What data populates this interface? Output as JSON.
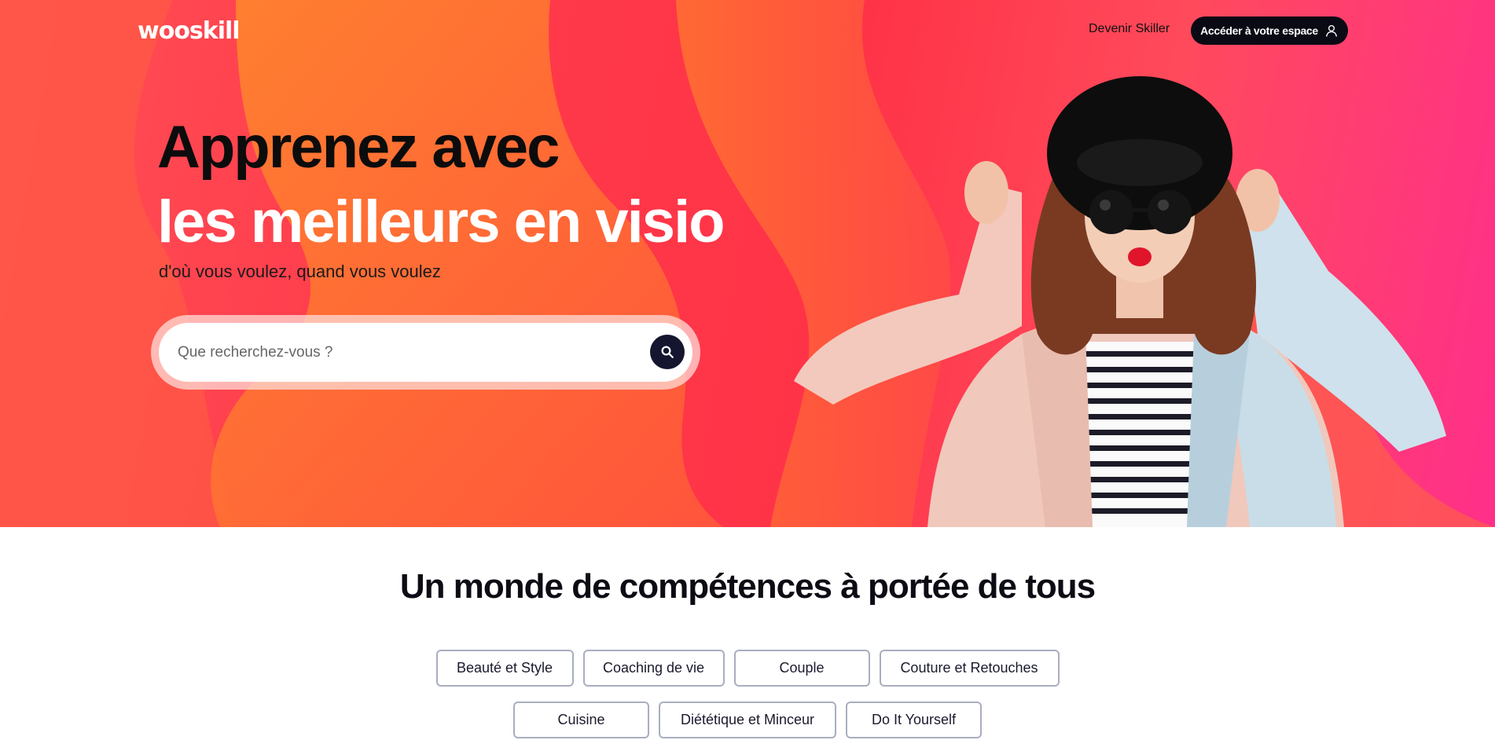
{
  "header": {
    "logo": "wooskill",
    "become_skiller": "Devenir Skiller",
    "account_button": "Accéder à votre espace",
    "account_icon": "user-icon"
  },
  "hero": {
    "headline_line1": "Apprenez avec",
    "headline_line2": "les meilleurs en visio",
    "subtitle": "d'où vous voulez, quand vous voulez",
    "search": {
      "placeholder": "Que recherchez-vous ?",
      "value": "",
      "icon": "search-icon"
    },
    "colors": {
      "bg_start": "#ff4f56",
      "bg_end": "#ff2f8a",
      "wave": "#ff7a2f",
      "headline_dark": "#0c0c0c"
    }
  },
  "section": {
    "title": "Un monde de compétences à portée de tous",
    "categories_row1": [
      "Beauté et Style",
      "Coaching de vie",
      "Couple",
      "Couture et Retouches"
    ],
    "categories_row2": [
      "Cuisine",
      "Diététique et Minceur",
      "Do It Yourself"
    ]
  }
}
